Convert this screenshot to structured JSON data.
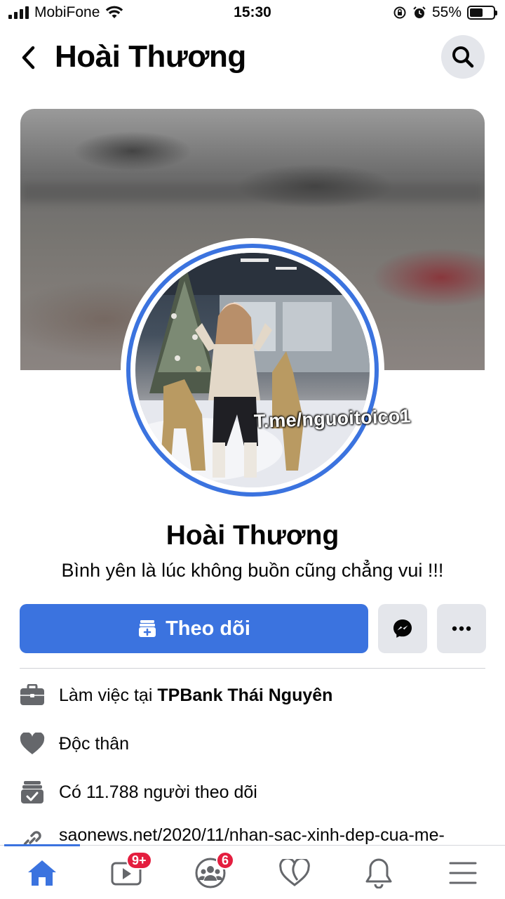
{
  "status_bar": {
    "carrier": "MobiFone",
    "time": "15:30",
    "battery": "55%",
    "battery_level": 0.55
  },
  "header": {
    "title": "Hoài Thương"
  },
  "avatar": {
    "watermark": "T.me/nguoitoico1"
  },
  "profile": {
    "name": "Hoài Thương",
    "bio": "Bình yên là lúc không buồn cũng chẳng vui !!!"
  },
  "actions": {
    "follow_label": "Theo dõi"
  },
  "details": {
    "work_prefix": "Làm việc tại",
    "work_place": "TPBank Thái Nguyên",
    "relationship": "Độc thân",
    "followers": "Có 11.788 người theo dõi",
    "link": "saonews.net/2020/11/nhan-sac-xinh-dep-cua-me-"
  },
  "nav": {
    "watch_badge": "9+",
    "groups_badge": "6"
  },
  "colors": {
    "accent": "#3b73df",
    "badge": "#e41e3f",
    "button_grey": "#e4e6eb"
  },
  "icons": [
    "back-arrow-icon",
    "search-icon",
    "follow-icon",
    "messenger-icon",
    "more-dots-icon",
    "briefcase-icon",
    "heart-icon",
    "followers-icon",
    "link-icon",
    "home-icon",
    "watch-icon",
    "groups-icon",
    "dating-icon",
    "bell-icon",
    "menu-icon"
  ]
}
